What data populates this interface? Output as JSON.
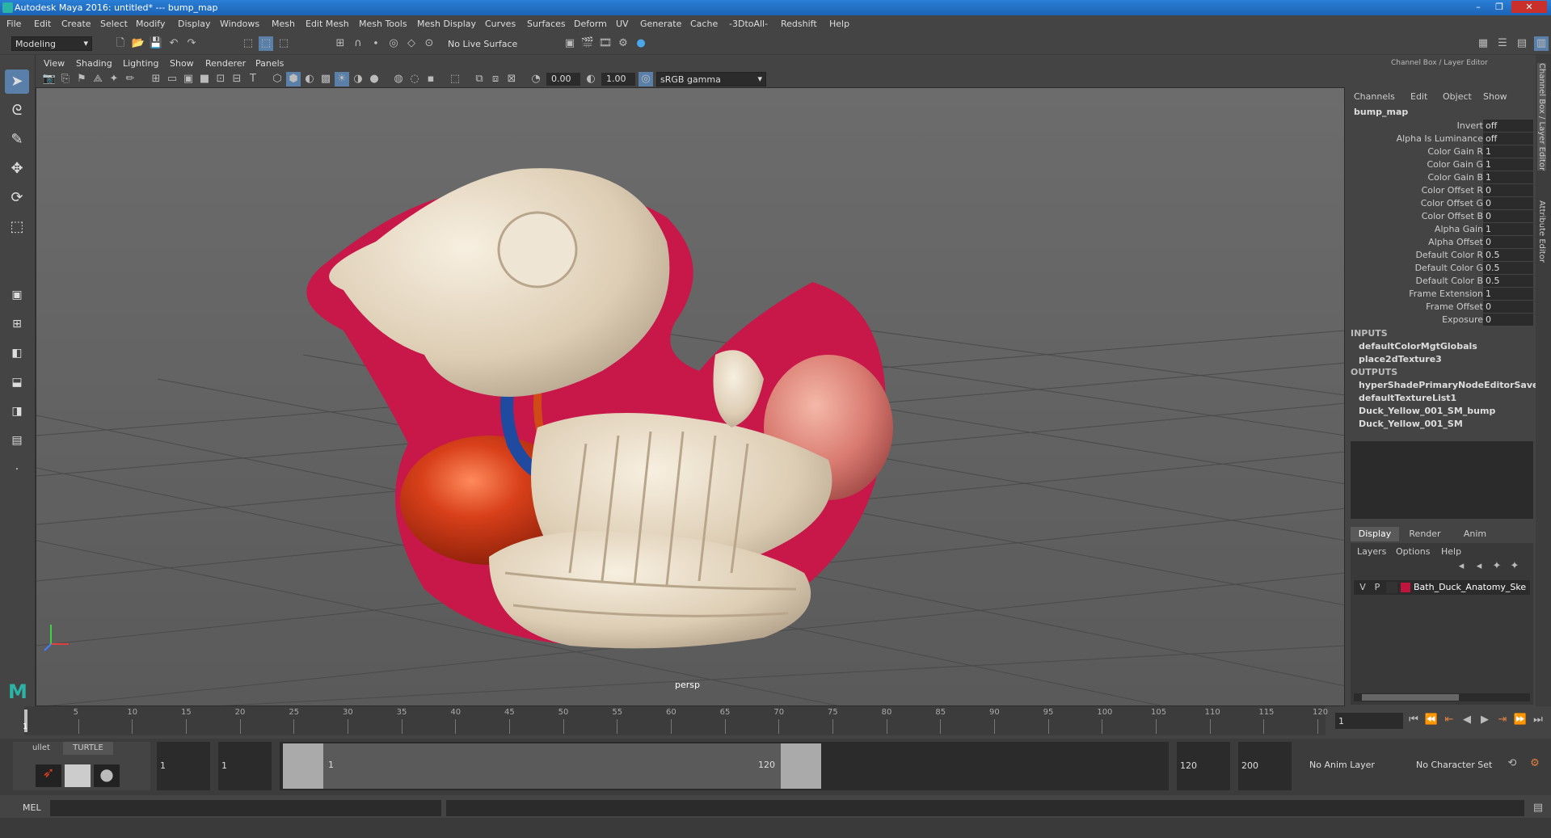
{
  "window": {
    "title": "Autodesk Maya 2016: untitled*   ---   bump_map",
    "controls": [
      "–",
      "❐",
      "✕"
    ]
  },
  "menubar": [
    "File",
    "Edit",
    "Create",
    "Select",
    "Modify",
    "Display",
    "Windows",
    "Mesh",
    "Edit Mesh",
    "Mesh Tools",
    "Mesh Display",
    "Curves",
    "Surfaces",
    "Deform",
    "UV",
    "Generate",
    "Cache",
    "-3DtoAll-",
    "Redshift",
    "Help"
  ],
  "statusline": {
    "menuset": "Modeling",
    "live_surface": "No Live Surface"
  },
  "panel_menu": [
    "View",
    "Shading",
    "Lighting",
    "Show",
    "Renderer",
    "Panels"
  ],
  "panel_toolbar": {
    "exposure": "0.00",
    "gamma": "1.00",
    "color_space": "sRGB gamma"
  },
  "viewport": {
    "camera_label": "persp"
  },
  "channel_box": {
    "header": "Channel Box / Layer Editor",
    "menus": [
      "Channels",
      "Edit",
      "Object",
      "Show"
    ],
    "node_name": "bump_map",
    "attributes": [
      {
        "label": "Invert",
        "value": "off"
      },
      {
        "label": "Alpha Is Luminance",
        "value": "off"
      },
      {
        "label": "Color Gain R",
        "value": "1"
      },
      {
        "label": "Color Gain G",
        "value": "1"
      },
      {
        "label": "Color Gain B",
        "value": "1"
      },
      {
        "label": "Color Offset R",
        "value": "0"
      },
      {
        "label": "Color Offset G",
        "value": "0"
      },
      {
        "label": "Color Offset B",
        "value": "0"
      },
      {
        "label": "Alpha Gain",
        "value": "1"
      },
      {
        "label": "Alpha Offset",
        "value": "0"
      },
      {
        "label": "Default Color R",
        "value": "0.5"
      },
      {
        "label": "Default Color G",
        "value": "0.5"
      },
      {
        "label": "Default Color B",
        "value": "0.5"
      },
      {
        "label": "Frame Extension",
        "value": "1"
      },
      {
        "label": "Frame Offset",
        "value": "0"
      },
      {
        "label": "Exposure",
        "value": "0"
      }
    ],
    "inputs_label": "INPUTS",
    "inputs": [
      "defaultColorMgtGlobals",
      "place2dTexture3"
    ],
    "outputs_label": "OUTPUTS",
    "outputs": [
      "hyperShadePrimaryNodeEditorSavedT...",
      "defaultTextureList1",
      "Duck_Yellow_001_SM_bump",
      "Duck_Yellow_001_SM"
    ]
  },
  "layer_editor": {
    "tabs": [
      "Display",
      "Render",
      "Anim"
    ],
    "menus": [
      "Layers",
      "Options",
      "Help"
    ],
    "layer": {
      "v": "V",
      "p": "P",
      "name": "Bath_Duck_Anatomy_Ske",
      "color": "#c0143c"
    }
  },
  "side_tabs": [
    "Channel Box / Layer Editor",
    "Attribute Editor"
  ],
  "time_slider": {
    "ticks": [
      "5",
      "10",
      "15",
      "20",
      "25",
      "30",
      "35",
      "40",
      "45",
      "50",
      "55",
      "60",
      "65",
      "70",
      "75",
      "80",
      "85",
      "90",
      "95",
      "100",
      "105",
      "110",
      "115",
      "120"
    ],
    "current_frame_marker": "1",
    "current_frame": "1"
  },
  "range_slider": {
    "shelf_tabs": [
      "ullet",
      "TURTLE"
    ],
    "start_time": "1",
    "playback_start": "1",
    "range_start_label": "1",
    "range_end_label": "120",
    "playback_end": "120",
    "end_time": "200",
    "anim_layer": "No Anim Layer",
    "character_set": "No Character Set"
  },
  "command_line": {
    "label": "MEL"
  },
  "colors": {
    "accent": "#2a7fd6",
    "duck_shell": "#c8184a",
    "bone": "#e4d6c0",
    "organ": "#c73012",
    "trachea": "#1f4aa0"
  }
}
